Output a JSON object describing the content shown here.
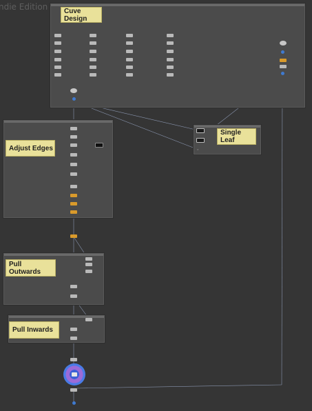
{
  "app": {
    "edition_label": "ndie Edition"
  },
  "network_boxes": {
    "cuve_design": {
      "label": "Cuve Design"
    },
    "single_leaf": {
      "label": "Single Leaf"
    },
    "adjust_edges": {
      "label": "Adjust Edges"
    },
    "pull_outwards": {
      "label": "Pull Outwards"
    },
    "pull_inwards": {
      "label": "Pull Inwards"
    }
  },
  "colors": {
    "background": "#353535",
    "network_box": "#4b4b4b",
    "sticky_note": "#e9e19a",
    "wire": "#8fa2c8",
    "selected_wire": "#6f8fe0",
    "orange_node": "#d99a2b",
    "blue_node": "#3f7ad0"
  },
  "icons": {
    "display_node": "target-ring-icon",
    "output_null": "x-marker-icon"
  }
}
